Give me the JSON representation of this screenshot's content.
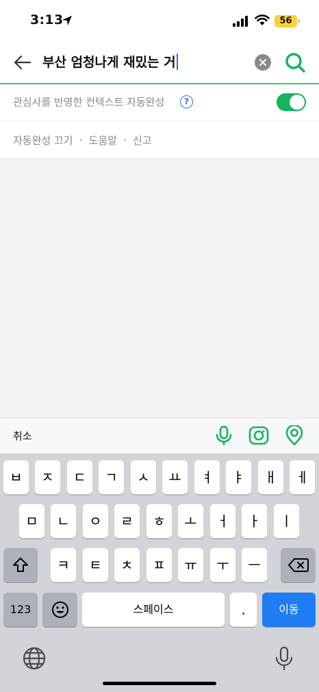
{
  "status": {
    "time": "3:13",
    "battery": "56"
  },
  "search": {
    "query": "부산 엄청나게 재밌는 거"
  },
  "context": {
    "label": "관심사를 반영한 컨텍스트 자동완성",
    "help": "?",
    "toggle_on": true
  },
  "links": [
    "자동완성 끄기",
    "도움말",
    "신고"
  ],
  "accessory": {
    "cancel": "취소"
  },
  "keyboard": {
    "row1": [
      "ㅂ",
      "ㅈ",
      "ㄷ",
      "ㄱ",
      "ㅅ",
      "ㅛ",
      "ㅕ",
      "ㅑ",
      "ㅐ",
      "ㅔ"
    ],
    "row2": [
      "ㅁ",
      "ㄴ",
      "ㅇ",
      "ㄹ",
      "ㅎ",
      "ㅗ",
      "ㅓ",
      "ㅏ",
      "ㅣ"
    ],
    "row3": [
      "ㅋ",
      "ㅌ",
      "ㅊ",
      "ㅍ",
      "ㅠ",
      "ㅜ",
      "ㅡ"
    ],
    "numbers": "123",
    "space": "스페이스",
    "period": ".",
    "go": "이동"
  },
  "colors": {
    "accent": "#16b35f",
    "link_blue": "#2d6cf6",
    "return_key": "#1f7cf2"
  }
}
